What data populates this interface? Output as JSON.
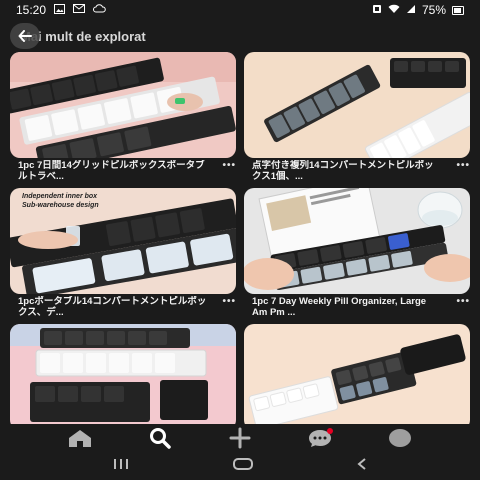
{
  "status": {
    "time": "15:20",
    "battery": "75%",
    "left_icons": [
      "image-icon",
      "gmail-icon",
      "cloud-icon"
    ],
    "right_icons": [
      "sim-icon",
      "wifi-icon",
      "signal-icon",
      "battery-icon"
    ]
  },
  "header": {
    "title": "Mai mult de explorat",
    "back_icon": "back-arrow-icon"
  },
  "pins": [
    {
      "caption": "1pc 7日間14グリッドピルボックスポータブルトラベ...",
      "more": "•••",
      "image": "white-black-pill-boxes"
    },
    {
      "caption": "点字付き複列14コンパートメントピルボックス1個、...",
      "more": "•••",
      "image": "grey-black-pill-organizer"
    },
    {
      "caption": "1pcポータブル14コンパートメントピルボックス、デ...",
      "more": "•••",
      "image": "hand-opening-pill-box",
      "overlay_line1": "Independent inner box",
      "overlay_line2": "Sub-warehouse design"
    },
    {
      "caption": "1pc 7 Day Weekly Pill Organizer, Large Am Pm ...",
      "more": "•••",
      "image": "hands-holding-pill-organizer"
    },
    {
      "caption": "",
      "more": "",
      "image": "stacked-pill-boxes"
    },
    {
      "caption": "",
      "more": "",
      "image": "three-pill-cases"
    }
  ],
  "bottom_nav": [
    "home-icon",
    "search-icon",
    "create-icon",
    "messages-icon",
    "profile-icon"
  ],
  "system_nav": [
    "recent-apps-icon",
    "home-button-icon",
    "back-icon"
  ],
  "colors": {
    "background": "#1b1b1b",
    "notification_dot": "#e60023"
  }
}
